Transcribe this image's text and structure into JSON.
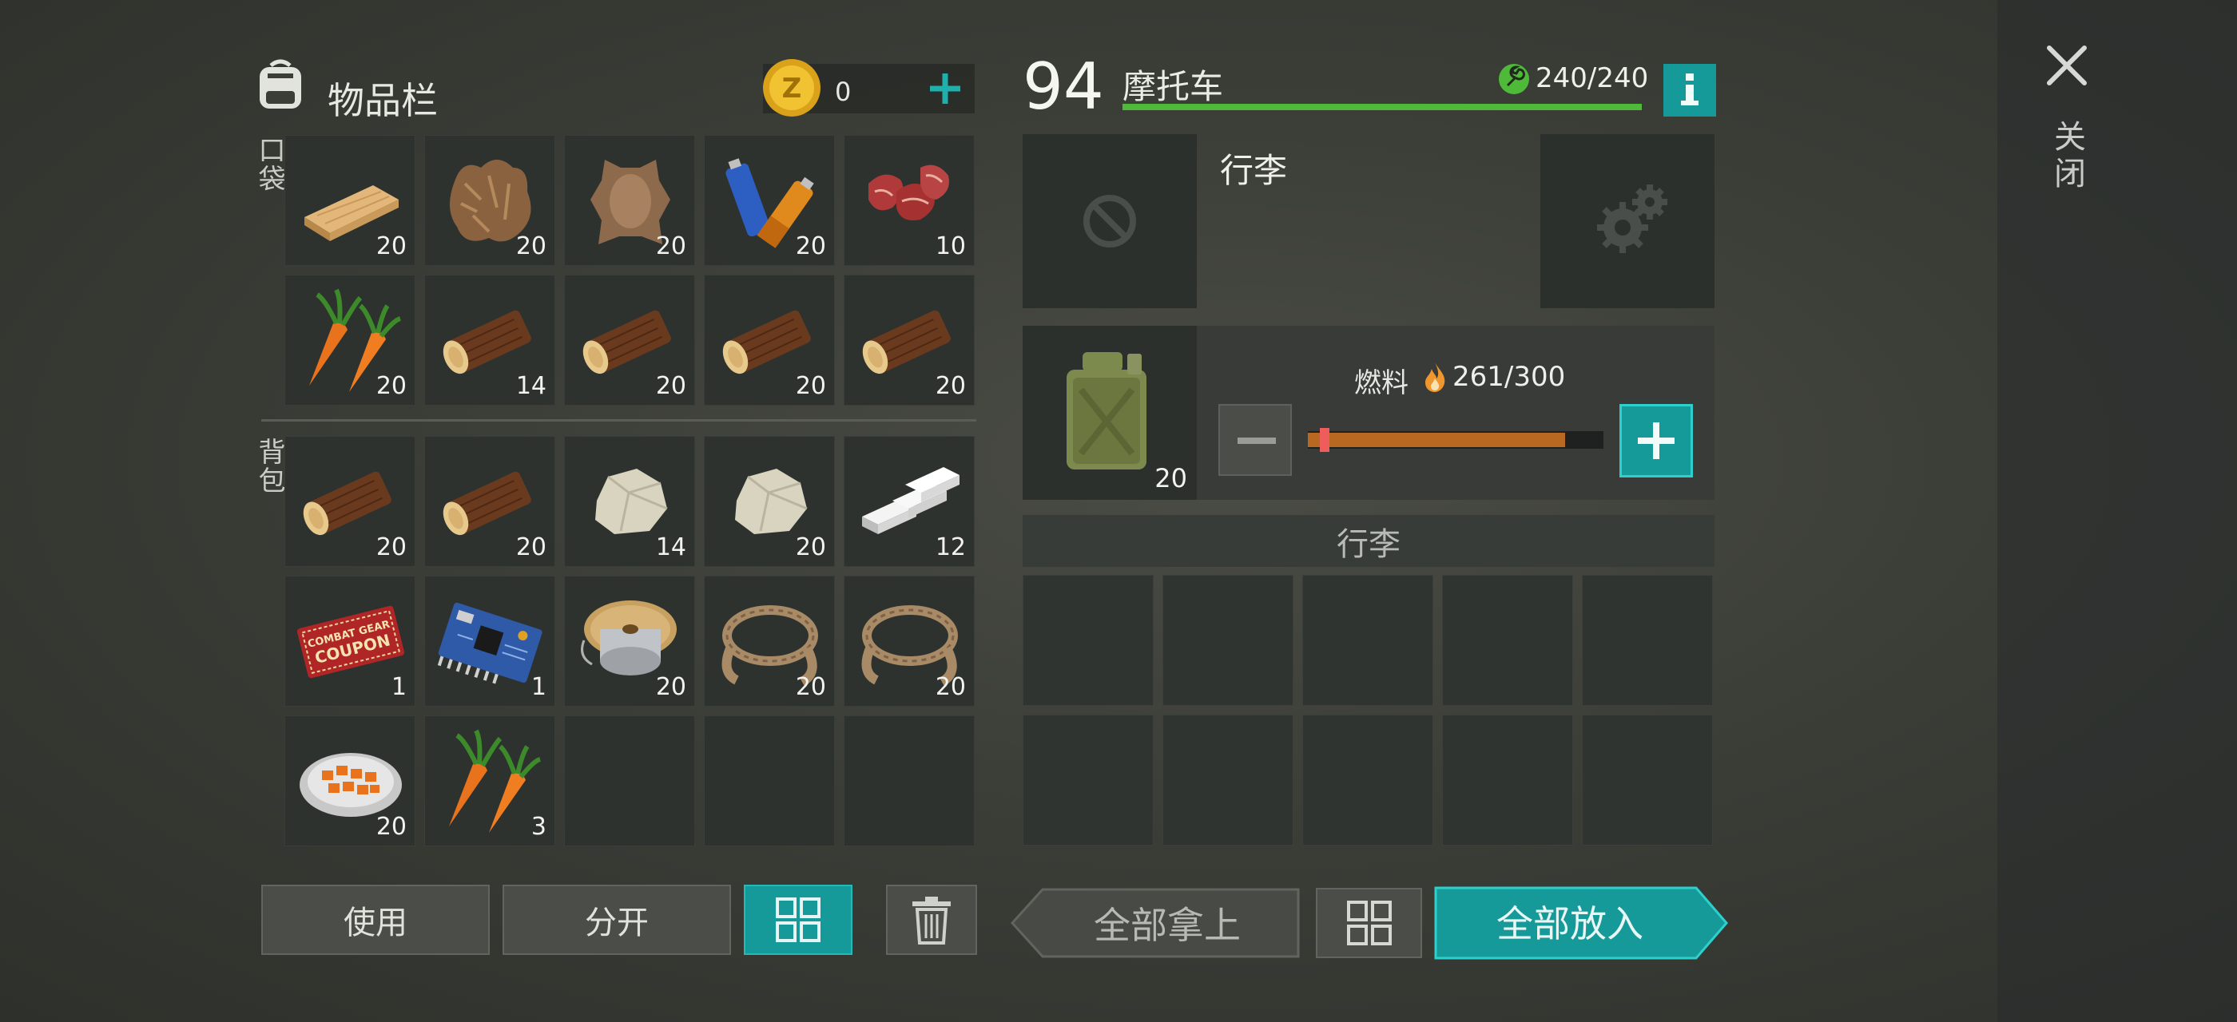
{
  "inventory": {
    "title": "物品栏",
    "coins": "0",
    "pocket_label": "口袋",
    "backpack_label": "背包",
    "pocket_items": [
      {
        "icon": "plank-icon",
        "qty": "20"
      },
      {
        "icon": "fur-icon",
        "qty": "20"
      },
      {
        "icon": "hide-icon",
        "qty": "20"
      },
      {
        "icon": "batteries-icon",
        "qty": "20"
      },
      {
        "icon": "raw-meat-icon",
        "qty": "10"
      },
      {
        "icon": "carrot-icon",
        "qty": "20"
      },
      {
        "icon": "log-icon",
        "qty": "14"
      },
      {
        "icon": "log-icon",
        "qty": "20"
      },
      {
        "icon": "log-icon",
        "qty": "20"
      },
      {
        "icon": "log-icon",
        "qty": "20"
      }
    ],
    "backpack_items": [
      {
        "icon": "log-icon",
        "qty": "20"
      },
      {
        "icon": "log-icon",
        "qty": "20"
      },
      {
        "icon": "stone-icon",
        "qty": "14"
      },
      {
        "icon": "stone-icon",
        "qty": "20"
      },
      {
        "icon": "iron-bars-icon",
        "qty": "12"
      },
      {
        "icon": "coupon-icon",
        "qty": "1"
      },
      {
        "icon": "circuit-board-icon",
        "qty": "1"
      },
      {
        "icon": "wire-spool-icon",
        "qty": "20"
      },
      {
        "icon": "rope-icon",
        "qty": "20"
      },
      {
        "icon": "rope-icon",
        "qty": "20"
      },
      {
        "icon": "cooked-carrots-icon",
        "qty": "20"
      },
      {
        "icon": "carrot-icon",
        "qty": "3"
      },
      {
        "icon": "",
        "qty": ""
      },
      {
        "icon": "",
        "qty": ""
      },
      {
        "icon": "",
        "qty": ""
      }
    ],
    "coupon_text": [
      "COMBAT GEAR",
      "COUPON"
    ],
    "buttons": {
      "use": "使用",
      "split": "分开"
    }
  },
  "vehicle": {
    "level": "94",
    "name": "摩托车",
    "durability": "240/240",
    "durability_fraction": 1.0,
    "storage_title": "行李",
    "fuel_label": "燃料",
    "fuel_value": "261/300",
    "fuel_fraction": 0.87,
    "fuel_can_qty": "20",
    "cargo_header": "行李",
    "take_all": "全部拿上",
    "put_all": "全部放入"
  },
  "close_label": "关闭",
  "colors": {
    "accent_teal": "#169a99",
    "durability_green": "#4fb93a",
    "fuel_orange": "#b86820",
    "handle_red": "#ef5c5c"
  }
}
